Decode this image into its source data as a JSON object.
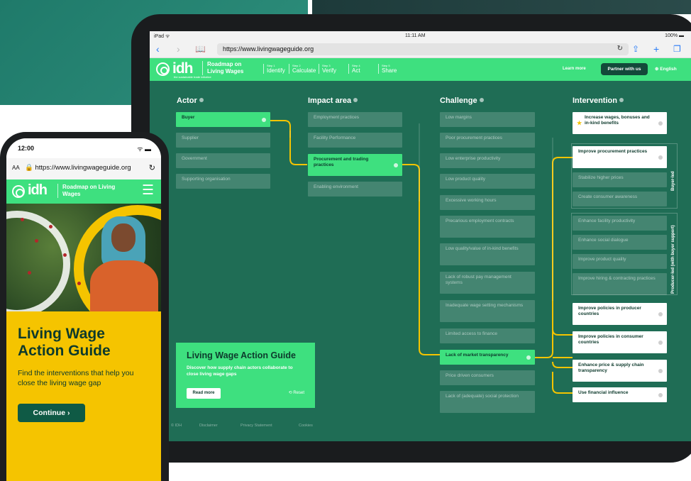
{
  "tablet": {
    "status": {
      "device": "iPad ᯤ",
      "time": "11:11 AM",
      "battery": "100% ▬"
    },
    "browser": {
      "url": "https://www.livingwageguide.org"
    },
    "site": {
      "logo": "idh",
      "logo_tag": "the sustainable trade initiative",
      "roadmap_title": "Roadmap on Living Wages",
      "steps": [
        {
          "num": "Step 1",
          "label": "Identify"
        },
        {
          "num": "Step 2",
          "label": "Calculate"
        },
        {
          "num": "Step 3",
          "label": "Verify"
        },
        {
          "num": "Step 4",
          "label": "Act"
        },
        {
          "num": "Step 5",
          "label": "Share"
        }
      ],
      "learn_more": "Learn more",
      "partner": "Partner with us",
      "language": "English"
    },
    "columns": {
      "actor": {
        "title": "Actor",
        "items": [
          "Buyer",
          "Supplier",
          "Government",
          "Supporting organisation"
        ]
      },
      "impact": {
        "title": "Impact area",
        "items": [
          "Employment practices",
          "Facility Performance",
          "Procurement and trading practices",
          "Enabling environment"
        ]
      },
      "challenge": {
        "title": "Challenge",
        "items": [
          "Low margins",
          "Poor procurement practices",
          "Low enterprise productivity",
          "Low product quality",
          "Excessive working hours",
          "Precarious employment contracts",
          "Low quality/value of in-kind benefits",
          "Lack of robust pay management systems",
          "Inadequate wage setting mechanisms",
          "Limited access to finance",
          "Lack of market transparency",
          "Price driven consumers",
          "Lack of (adequate) social protection"
        ]
      },
      "intervention": {
        "title": "Intervention",
        "items": [
          "Increase wages, bonuses and in-kind benefits",
          "Improve procurement practices",
          "Stabilize higher prices",
          "Create consumer awareness",
          "Enhance facility productivity",
          "Enhance social dialogue",
          "Improve product quality",
          "Improve hiring & contracting practices",
          "Improve policies in producer countries",
          "Improve policies in consumer countries",
          "Enhance price & supply chain transparency",
          "Use financial influence"
        ],
        "group_buyer": "Buyer-led",
        "group_producer": "Producer-led (with buyer support)"
      }
    },
    "guide": {
      "title": "Living Wage Action Guide",
      "desc": "Discover how supply chain actors collaborate to close living wage gaps",
      "read_more": "Read more",
      "reset": "⟲ Reset"
    },
    "footer": [
      "© IDH",
      "Disclaimer",
      "Privacy Statement",
      "Cookies"
    ]
  },
  "phone": {
    "time": "12:00",
    "status_icons": "ᯤ ▬",
    "url_aa": "AA",
    "url": "🔒 https://www.livingwageguide.org",
    "logo": "idh",
    "roadmap_title": "Roadmap on Living Wages",
    "menu_icon": "☰",
    "headline": "Living Wage Action Guide",
    "subtext": "Find the interventions that help you close the living wage gap",
    "cta": "Continue ›"
  },
  "colors": {
    "brand_green": "#3ee07f",
    "dark_green": "#1f6d55",
    "yellow": "#f5c400",
    "link_yellow": "#f2c300"
  }
}
